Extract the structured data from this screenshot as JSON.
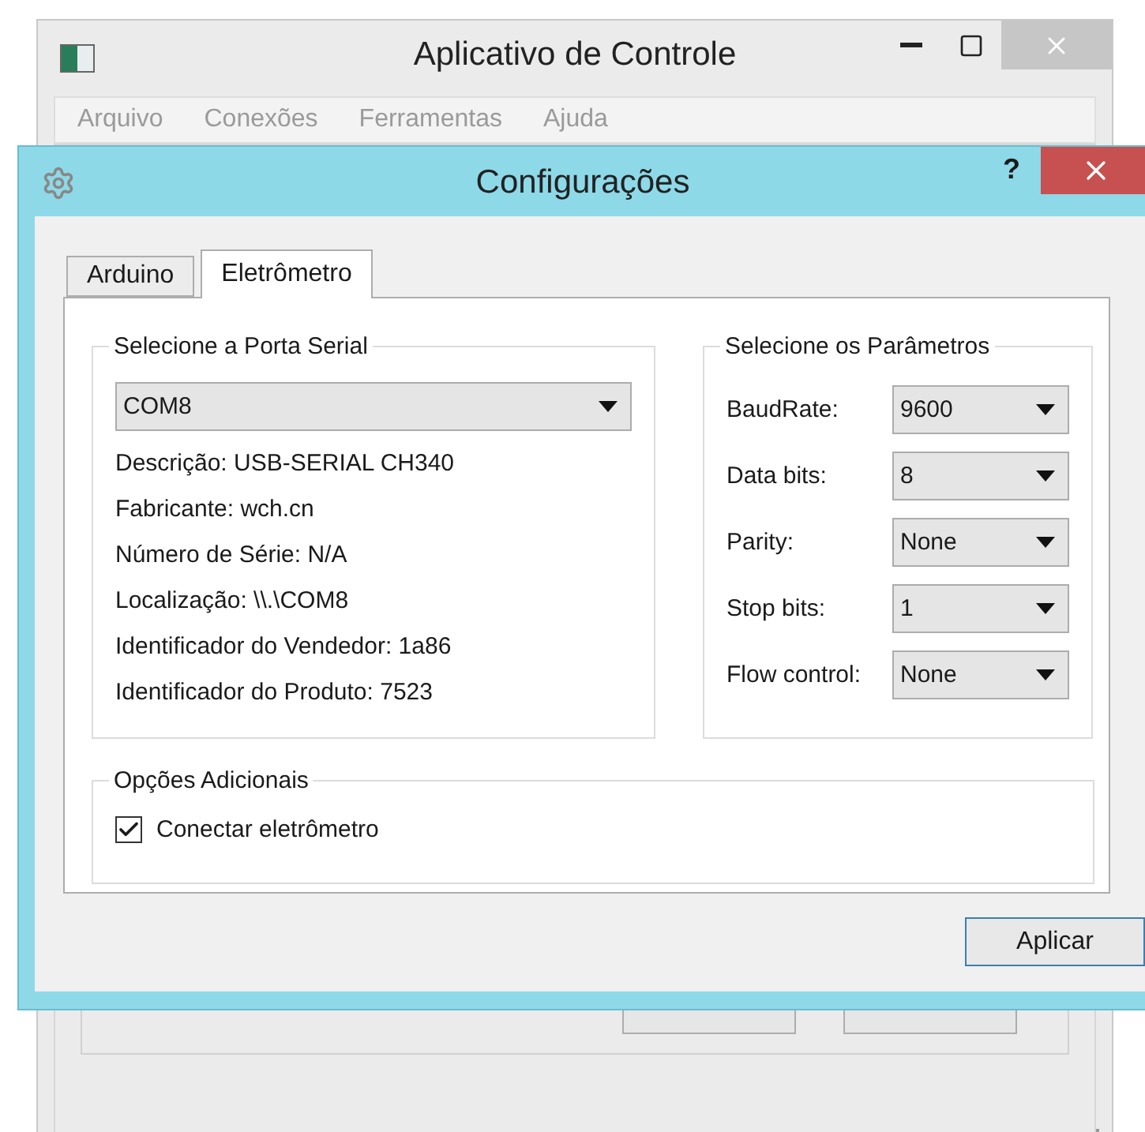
{
  "main_window": {
    "title": "Aplicativo de Controle",
    "menu": [
      "Arquivo",
      "Conexões",
      "Ferramentas",
      "Ajuda"
    ]
  },
  "dialog": {
    "title": "Configurações",
    "help": "?",
    "tabs": [
      {
        "label": "Arduino",
        "selected": false
      },
      {
        "label": "Eletrômetro",
        "selected": true
      }
    ],
    "serial_group": {
      "title": "Selecione a Porta Serial",
      "port": "COM8",
      "info": [
        "Descrição: USB-SERIAL CH340",
        "Fabricante: wch.cn",
        "Número de Série: N/A",
        "Localização: \\\\.\\COM8",
        "Identificador do Vendedor: 1a86",
        "Identificador do Produto: 7523"
      ]
    },
    "params_group": {
      "title": "Selecione os Parâmetros",
      "fields": [
        {
          "label": "BaudRate:",
          "value": "9600"
        },
        {
          "label": "Data bits:",
          "value": "8"
        },
        {
          "label": "Parity:",
          "value": "None"
        },
        {
          "label": "Stop bits:",
          "value": "1"
        },
        {
          "label": "Flow control:",
          "value": "None"
        }
      ]
    },
    "options_group": {
      "title": "Opções Adicionais",
      "checkboxes": [
        {
          "label": "Conectar eletrômetro",
          "checked": true
        }
      ]
    },
    "apply_button": "Aplicar"
  }
}
